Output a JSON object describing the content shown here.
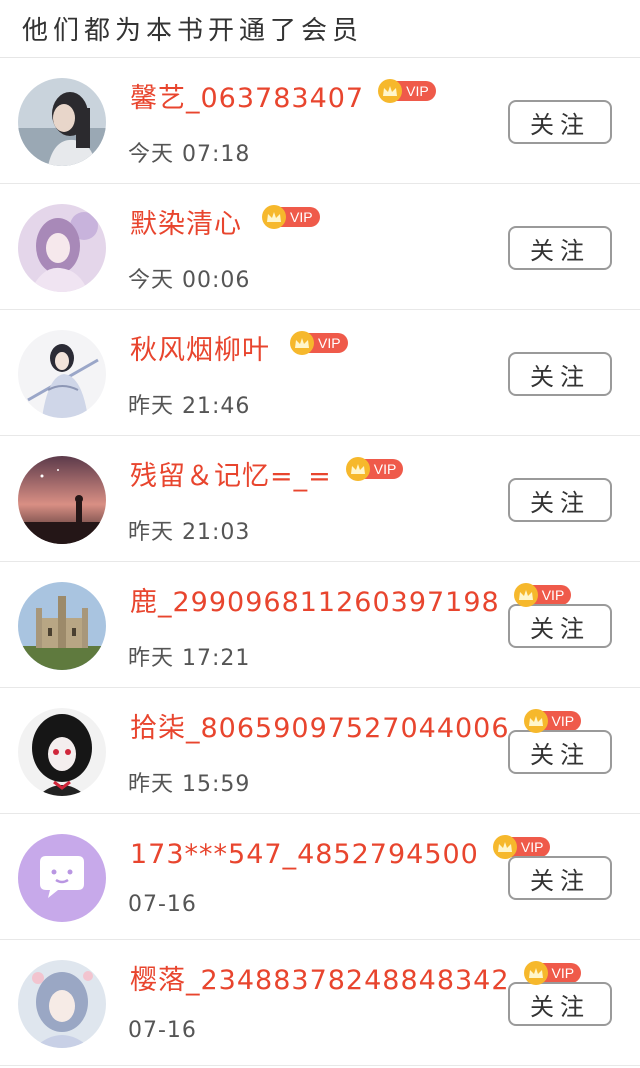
{
  "header": {
    "title": "他们都为本书开通了会员"
  },
  "vip_label": "VIP",
  "colors": {
    "name": "#e8452e",
    "vip_tag": "#ef5a4a",
    "vip_crown": "#f6b82c",
    "border": "#9a9a9a"
  },
  "members": [
    {
      "name": "馨艺_063783407",
      "time": "今天  07:18",
      "follow_label": "关注",
      "avatar_icon": "girl-portrait-avatar"
    },
    {
      "name": "默染清心",
      "time": "今天  00:06",
      "follow_label": "关注",
      "avatar_icon": "anime-girl-avatar"
    },
    {
      "name": "秋风烟柳叶",
      "time": "昨天  21:46",
      "follow_label": "关注",
      "avatar_icon": "anime-swordsman-avatar"
    },
    {
      "name": "残留＆记忆=_=",
      "time": "昨天  21:03",
      "follow_label": "关注",
      "avatar_icon": "sunset-silhouette-avatar"
    },
    {
      "name": "鹿_299096811260397198",
      "time": "昨天  17:21",
      "follow_label": "关注",
      "avatar_icon": "castle-avatar"
    },
    {
      "name": "拾柒_80659097527044006",
      "time": "昨天  15:59",
      "follow_label": "关注",
      "avatar_icon": "anime-dark-girl-avatar"
    },
    {
      "name": "173***547_4852794500",
      "time": "07-16",
      "follow_label": "关注",
      "avatar_icon": "chat-bubble-avatar"
    },
    {
      "name": "樱落_23488378248848342",
      "time": "07-16",
      "follow_label": "关注",
      "avatar_icon": "anime-princess-avatar"
    }
  ]
}
